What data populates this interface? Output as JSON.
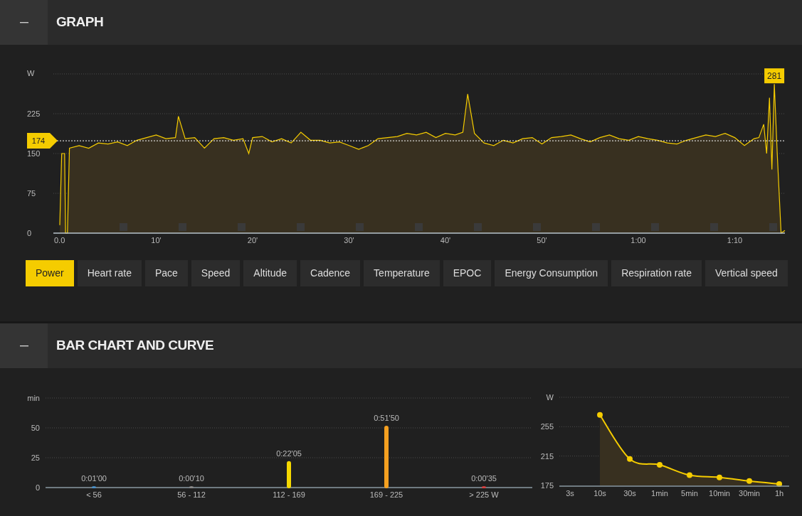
{
  "sections": [
    {
      "title": "GRAPH",
      "expanded": true,
      "graph": {
        "chart_data": {
          "type": "area",
          "ylabel": "W",
          "x": [
            0,
            0.2,
            0.5,
            0.6,
            0.8,
            1,
            2,
            3,
            4,
            5,
            6,
            7,
            8,
            9,
            10,
            11,
            12,
            12.3,
            13,
            14,
            15,
            16,
            17,
            18,
            19,
            19.6,
            20,
            21,
            22,
            23,
            24,
            25,
            26,
            27,
            28,
            29,
            30,
            31,
            32,
            33,
            34,
            35,
            36,
            37,
            38,
            39,
            40,
            41,
            41.8,
            42.3,
            43,
            44,
            45,
            46,
            47,
            48,
            49,
            50,
            51,
            52,
            53,
            54,
            55,
            56,
            57,
            58,
            59,
            60,
            61,
            62,
            63,
            64,
            65,
            66,
            67,
            68,
            69,
            70,
            71,
            72,
            72.5,
            73,
            73.3,
            73.6,
            73.85,
            74.1,
            74.4,
            74.8,
            75.2
          ],
          "series": [
            {
              "color": "#f5cc00",
              "values": [
                15,
                150,
                150,
                0,
                0,
                160,
                165,
                160,
                170,
                168,
                172,
                165,
                175,
                180,
                185,
                178,
                180,
                220,
                178,
                180,
                160,
                178,
                180,
                175,
                178,
                150,
                180,
                182,
                172,
                178,
                170,
                190,
                175,
                175,
                170,
                172,
                165,
                158,
                165,
                178,
                180,
                182,
                188,
                185,
                190,
                180,
                188,
                185,
                190,
                262,
                188,
                170,
                165,
                175,
                170,
                178,
                180,
                168,
                180,
                182,
                185,
                178,
                172,
                180,
                185,
                178,
                175,
                182,
                178,
                175,
                170,
                168,
                175,
                180,
                185,
                182,
                188,
                180,
                165,
                178,
                180,
                205,
                150,
                255,
                120,
                281,
                150,
                0,
                5
              ]
            }
          ],
          "xlim": [
            0,
            75.2
          ],
          "ylim": [
            0,
            300
          ],
          "yticks": [
            0,
            75,
            150,
            225
          ],
          "grid": true,
          "xticks": [
            {
              "value": 0,
              "label": "0.0"
            },
            {
              "value": 10,
              "label": "10'"
            },
            {
              "value": 20,
              "label": "20'"
            },
            {
              "value": 30,
              "label": "30'"
            },
            {
              "value": 40,
              "label": "40'"
            },
            {
              "value": 50,
              "label": "50'"
            },
            {
              "value": 60,
              "label": "1:00"
            },
            {
              "value": 70,
              "label": "1:10"
            }
          ],
          "ref_lines": [
            {
              "axis": "y",
              "value": 174,
              "label": "174"
            }
          ],
          "annotations": [
            {
              "x": 74.1,
              "y": 281,
              "text": "281"
            }
          ]
        }
      },
      "tabs": [
        {
          "label": "Power",
          "selected": true
        },
        {
          "label": "Heart rate",
          "selected": false
        },
        {
          "label": "Pace",
          "selected": false
        },
        {
          "label": "Speed",
          "selected": false
        },
        {
          "label": "Altitude",
          "selected": false
        },
        {
          "label": "Cadence",
          "selected": false
        },
        {
          "label": "Temperature",
          "selected": false
        },
        {
          "label": "EPOC",
          "selected": false
        },
        {
          "label": "Energy Consumption",
          "selected": false
        },
        {
          "label": "Respiration rate",
          "selected": false
        },
        {
          "label": "Vertical speed",
          "selected": false
        }
      ]
    },
    {
      "title": "BAR CHART AND CURVE",
      "expanded": true,
      "zones": [
        {
          "color": "#4a90c8"
        },
        {
          "color": "#8a8a8a"
        },
        {
          "color": "#f5d800"
        },
        {
          "color": "#f5a020"
        },
        {
          "color": "#d84040"
        }
      ],
      "zone_chart": {
        "chart_data": {
          "type": "bar",
          "ylabel": "min",
          "categories": [
            "< 56",
            "56 - 112",
            "112 - 169",
            "169 - 225",
            "> 225 W"
          ],
          "series": [
            {
              "values": [
                1.0,
                0.2,
                22.1,
                51.8,
                0.6
              ]
            }
          ],
          "ylim": [
            0,
            75
          ],
          "yticks": [
            0,
            25,
            50
          ],
          "value_labels": [
            "0:01'00",
            "0:00'10",
            "0:22'05",
            "0:51'50",
            "0:00'35"
          ]
        }
      },
      "curve": {
        "chart_data": {
          "type": "area",
          "ylabel": "W",
          "categories": [
            "3s",
            "10s",
            "30s",
            "1min",
            "5min",
            "10min",
            "30min",
            "1h"
          ],
          "series": [
            {
              "color": "#f5cc00",
              "values": [
                null,
                271,
                211,
                203,
                189,
                186,
                181,
                177
              ]
            }
          ],
          "ylim": [
            175,
            295
          ],
          "yticks": [
            175,
            215,
            255
          ]
        }
      }
    }
  ]
}
